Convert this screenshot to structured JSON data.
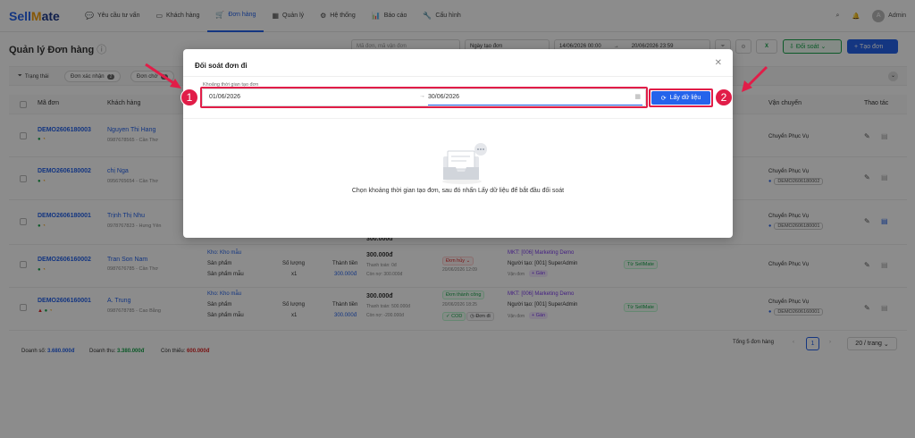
{
  "app": {
    "logo_a": "Sell",
    "logo_b": "M",
    "logo_c": "ate"
  },
  "nav": [
    {
      "label": "Yêu cầu tư vấn",
      "icon": "chat-icon"
    },
    {
      "label": "Khách hàng",
      "icon": "user-card-icon"
    },
    {
      "label": "Đơn hàng",
      "icon": "cart-icon"
    },
    {
      "label": "Quản lý",
      "icon": "grid-icon"
    },
    {
      "label": "Hệ thống",
      "icon": "gear-icon"
    },
    {
      "label": "Báo cáo",
      "icon": "chart-icon"
    },
    {
      "label": "Cấu hình",
      "icon": "wrench-icon"
    }
  ],
  "user": {
    "avatar": "A",
    "name": "Admin"
  },
  "page": {
    "title": "Quản lý Đơn hàng"
  },
  "toolbar": {
    "search_placeholder": "Mã đơn, mã vận đơn",
    "date_type": "Ngày tạo đơn",
    "date_from": "14/06/2026 00:00",
    "date_to": "20/06/2026 23:59",
    "reconcile_label": "Đối soát",
    "create_label": "Tạo đơn"
  },
  "filters": [
    {
      "label": "Trạng thái"
    },
    {
      "label": "Đơn xác nhận",
      "count": "2"
    },
    {
      "label": "Đơn chờ",
      "count": "3"
    }
  ],
  "table": {
    "headers": [
      "Mã đơn",
      "Khách hàng",
      "Vận chuyển",
      "Thao tác"
    ],
    "rows": [
      {
        "id": "DEMO2606180003",
        "name": "Nguyen Thi Hang",
        "phone": "0987678565 - Cần Thơ",
        "ship": "Chuyển Phục Vụ",
        "code": ""
      },
      {
        "id": "DEMO2606180002",
        "name": "chị Nga",
        "phone": "0956765654 - Cần Thơ",
        "ship": "Chuyển Phục Vụ",
        "code": "DEMO2606180002"
      },
      {
        "id": "DEMO2606180001",
        "name": "Trịnh Thị Nhu",
        "phone": "0978767823 - Hưng Yên",
        "ship": "Chuyển Phục Vụ",
        "code": "DEMO2606180001"
      },
      {
        "id": "DEMO2606160002",
        "name": "Tran Son Nam",
        "phone": "0987676785 - Cần Thơ",
        "ship": "Chuyển Phục Vụ",
        "code": "",
        "warehouse": "Kho: Kho mẫu",
        "product_h": "Sản phẩm",
        "product": "Sản phẩm mẫu",
        "qty_h": "Số lượng",
        "qty": "x1",
        "total_h": "Thành tiền",
        "total": "300.000đ",
        "amount": "300.000đ",
        "paid": "Thanh toán: 0đ",
        "remain": "Còn nợ: 300.000đ",
        "status": "Đơn hủy",
        "status_time": "20/06/2026 12:09",
        "mkt": "MKT: [006] Marketing Demo",
        "creator": "Người tạo: [001] SuperAdmin",
        "shipper": "Vận đơn",
        "assign": "+ Gán",
        "source": "Từ SellMate"
      },
      {
        "id": "DEMO2606160001",
        "name": "A. Trung",
        "phone": "0987678785 - Cao Bằng",
        "ship": "Chuyển Phục Vụ",
        "code": "DEMO2606160001",
        "warehouse": "Kho: Kho mẫu",
        "product_h": "Sản phẩm",
        "product": "Sản phẩm mẫu",
        "qty_h": "Số lượng",
        "qty": "x1",
        "total_h": "Thành tiền",
        "total": "300.000đ",
        "amount": "300.000đ",
        "paid": "Thanh toán: 500.000đ",
        "remain": "Còn nợ: -200.000đ",
        "status": "Đơn thành công",
        "status_time": "20/06/2026 18:25",
        "cod": "COD",
        "done": "Đơn đi",
        "mkt": "MKT: [006] Marketing Demo",
        "creator": "Người tạo: [001] SuperAdmin",
        "shipper": "Vận đơn",
        "assign": "+ Gán",
        "source": "Từ SellMate"
      }
    ],
    "partial_amounts": [
      "300.000đ"
    ]
  },
  "footer": {
    "revenue_label": "Doanh số:",
    "revenue": "3.680.000đ",
    "income_label": "Doanh thu:",
    "income": "3.380.000đ",
    "owed_label": "Còn thiếu:",
    "owed": "600.000đ",
    "total_text": "Tổng 5 đơn hàng",
    "page": "1",
    "page_size": "20 / trang"
  },
  "modal": {
    "title": "Đối soát đơn đi",
    "range_label": "Khoảng thời gian tạo đơn",
    "start": "01/06/2026",
    "end": "30/06/2026",
    "fetch_label": "Lấy dữ liệu",
    "empty_text": "Chọn khoảng thời gian tạo đơn, sau đó nhấn Lấy dữ liệu để bắt đầu đối soát"
  },
  "annotations": {
    "step1": "1",
    "step2": "2"
  },
  "colors": {
    "accent": "#2563eb",
    "annotation": "#e11d48",
    "success": "#16a34a",
    "danger": "#dc2626"
  }
}
